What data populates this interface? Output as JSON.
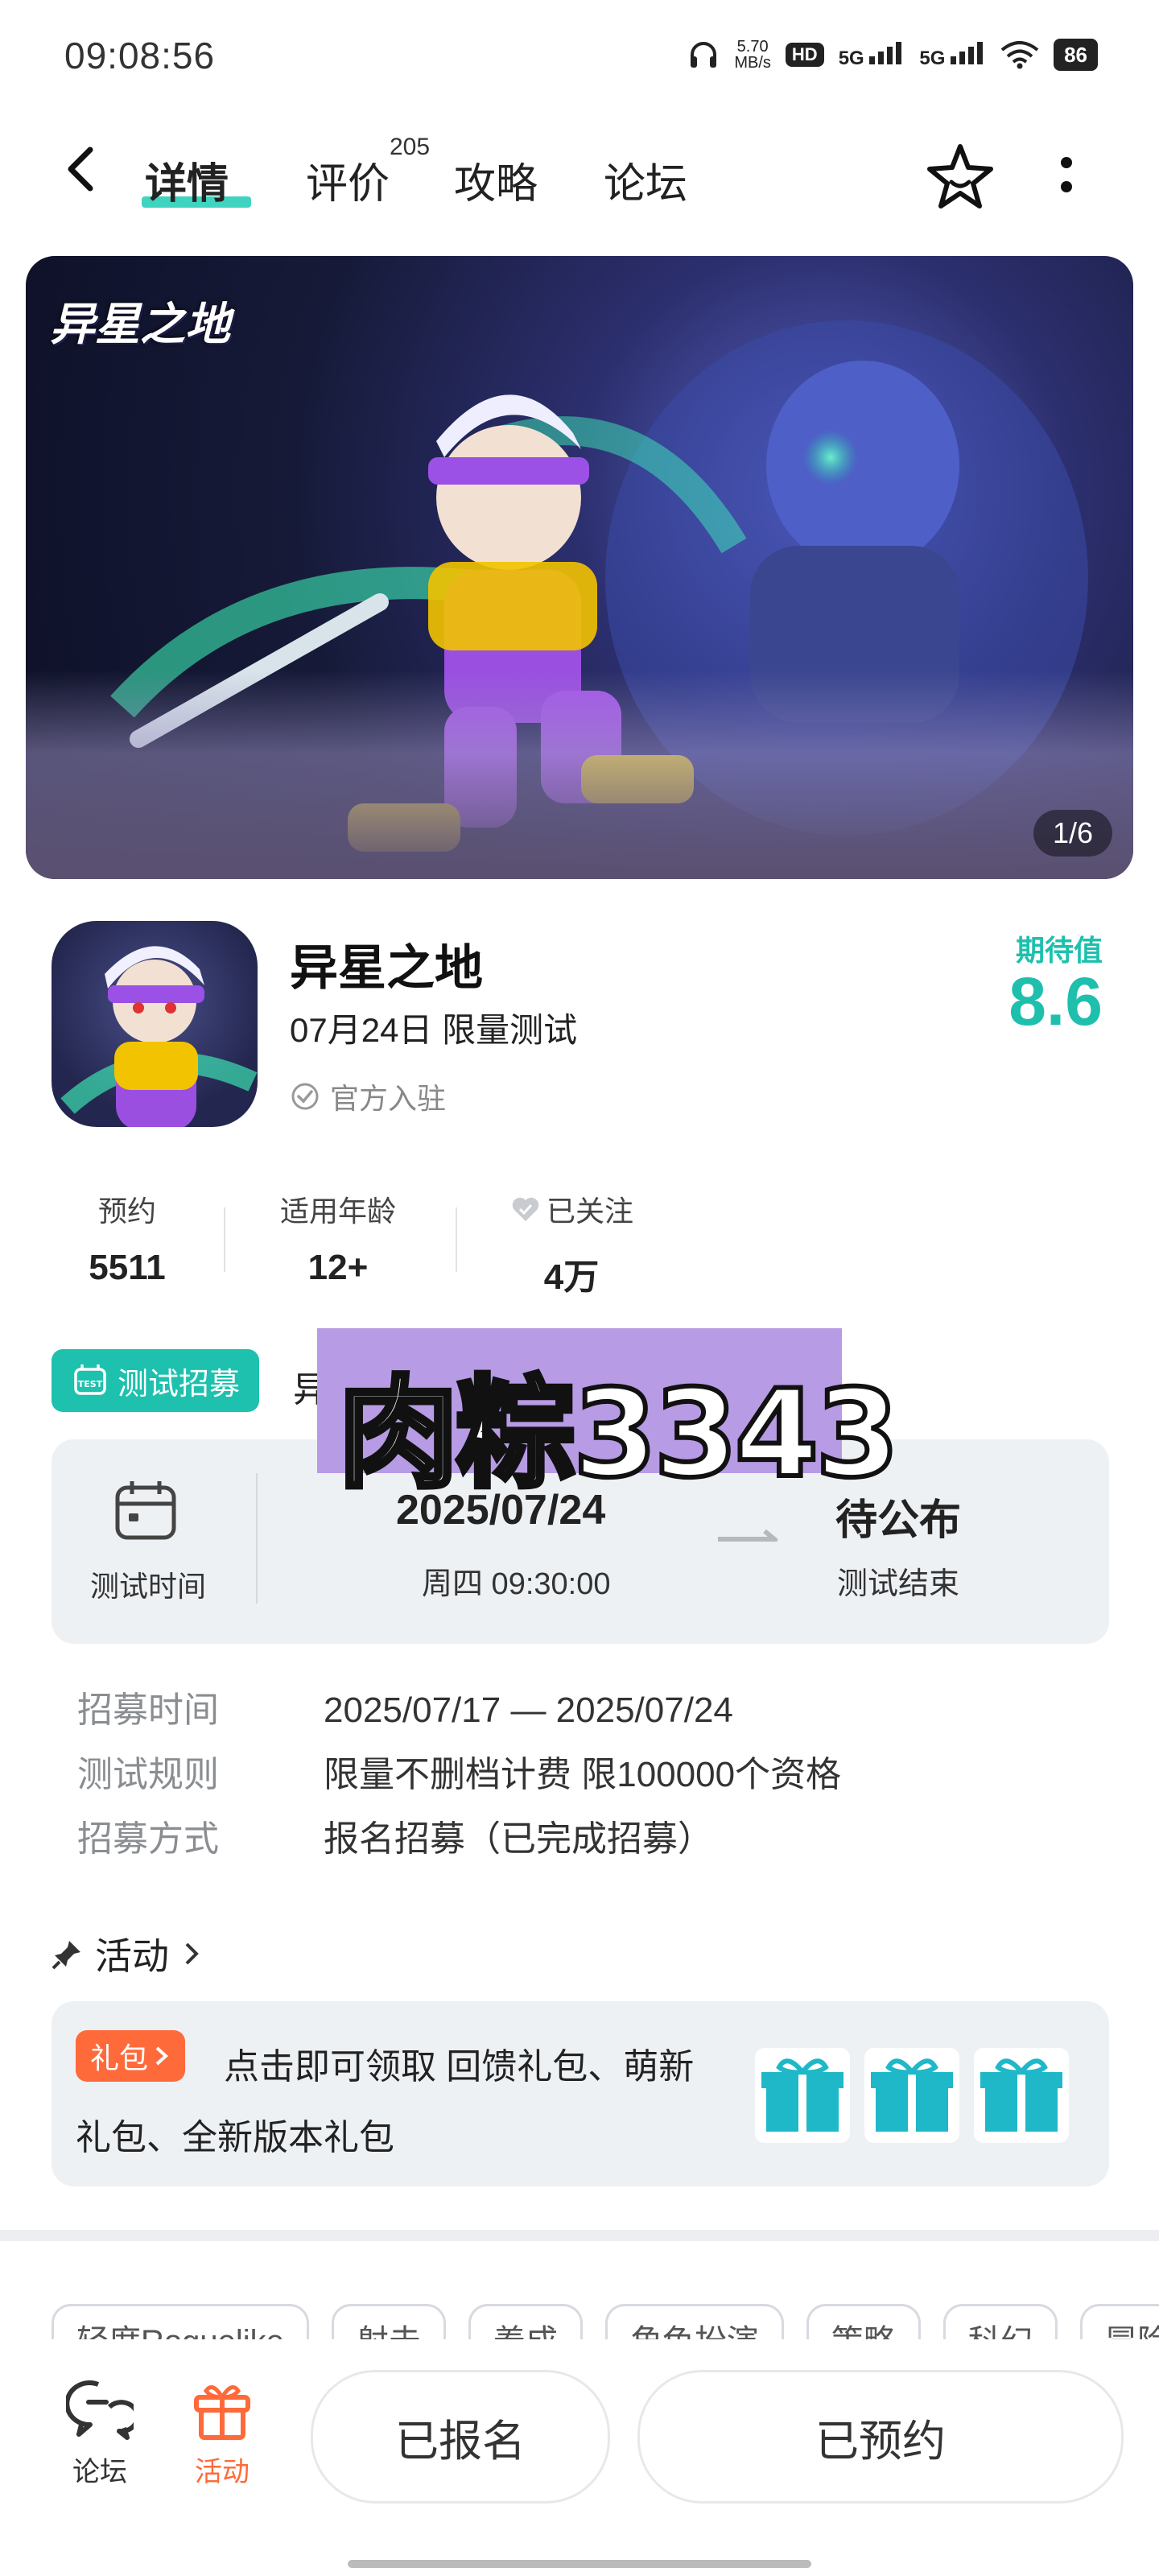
{
  "status_bar": {
    "time": "09:08:56",
    "speed_value": "5.70",
    "speed_unit": "MB/s",
    "hd_label": "HD",
    "net1": "5G",
    "net2": "5G",
    "battery": "86"
  },
  "nav": {
    "tabs": [
      {
        "label": "详情",
        "active": true
      },
      {
        "label": "评价",
        "count": "205"
      },
      {
        "label": "攻略"
      },
      {
        "label": "论坛"
      }
    ]
  },
  "banner": {
    "logo_text": "异星之地",
    "pager": "1/6"
  },
  "game": {
    "name": "异星之地",
    "test_date": "07月24日 限量测试",
    "official": "官方入驻",
    "rating_label": "期待值",
    "rating_value": "8.6"
  },
  "stats": [
    {
      "label": "预约",
      "value": "5511"
    },
    {
      "label": "适用年龄",
      "value": "12+"
    },
    {
      "label": "已关注",
      "value": "4万"
    }
  ],
  "recruit": {
    "badge": "测试招募",
    "title_visible": "异",
    "watermark": "肉粽3343",
    "time_label": "测试时间",
    "start_date": "2025/07/24",
    "start_time": "周四  09:30:00",
    "end_status": "待公布",
    "end_label": "测试结束",
    "details": [
      {
        "k": "招募时间",
        "v": "2025/07/17 — 2025/07/24"
      },
      {
        "k": "测试规则",
        "v": "限量不删档计费 限100000个资格"
      },
      {
        "k": "招募方式",
        "v": "报名招募（已完成招募）"
      }
    ]
  },
  "activity": {
    "title": "活动",
    "gift_tag": "礼包",
    "text": "点击即可领取 回馈礼包、萌新礼包、全新版本礼包"
  },
  "tags": [
    "轻度Roguelike",
    "射击",
    "养成",
    "角色扮演",
    "策略",
    "科幻",
    "冒险"
  ],
  "bottom": {
    "forum": "论坛",
    "activity": "活动",
    "signed_up": "已报名",
    "reserved": "已预约"
  },
  "colors": {
    "accent": "#1ec0ad",
    "orange": "#ff6a3a"
  }
}
